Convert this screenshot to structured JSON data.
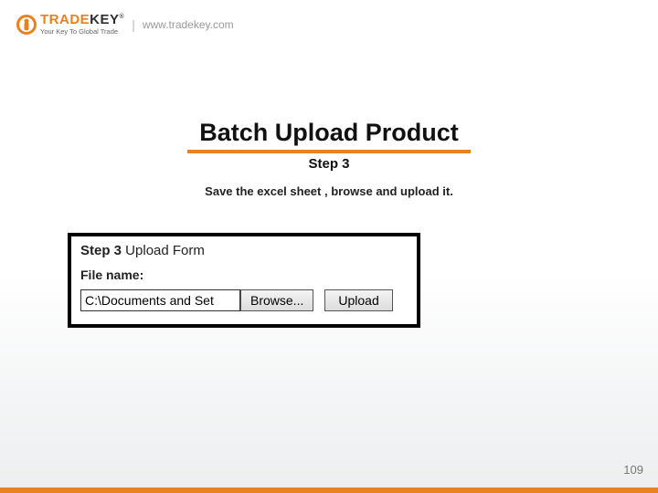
{
  "header": {
    "brand_part1": "TRADE",
    "brand_part2": "KEY",
    "trademark": "®",
    "tagline": "Your Key To Global Trade",
    "divider": "|",
    "url": "www.tradekey.com"
  },
  "title": {
    "main": "Batch Upload Product",
    "sub": "Step 3"
  },
  "instruction": "Save the excel sheet , browse and upload it.",
  "panel": {
    "step_prefix": "Step 3",
    "step_suffix": " Upload Form",
    "filename_label": "File name:",
    "file_value": "C:\\Documents and Set",
    "browse_label": "Browse...",
    "upload_label": "Upload"
  },
  "page_number": "109"
}
